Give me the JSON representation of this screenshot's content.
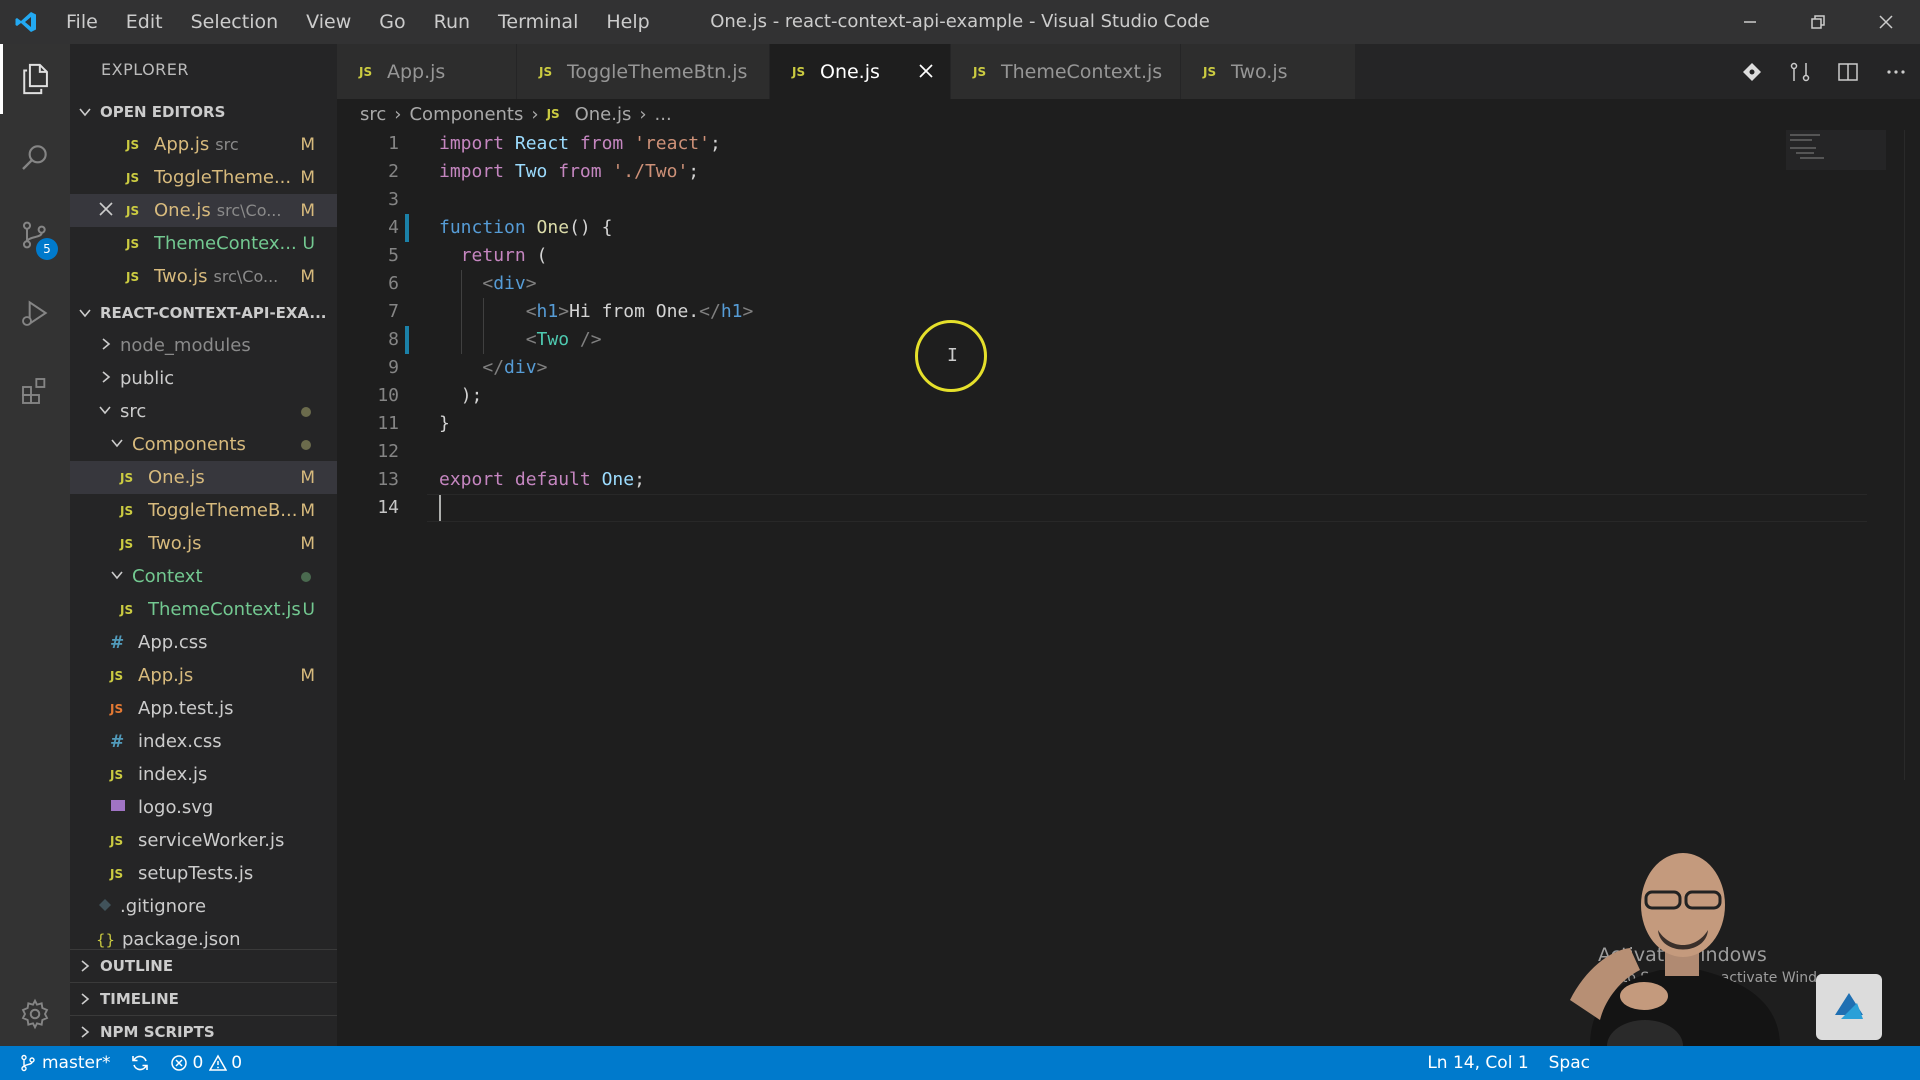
{
  "window": {
    "title": "One.js - react-context-api-example - Visual Studio Code",
    "menu": [
      "File",
      "Edit",
      "Selection",
      "View",
      "Go",
      "Run",
      "Terminal",
      "Help"
    ]
  },
  "activity_bar": {
    "items": [
      "explorer-icon",
      "search-icon",
      "source-control-icon",
      "run-debug-icon",
      "extensions-icon"
    ],
    "scm_badge": "5",
    "bottom": "gear-icon"
  },
  "sidebar": {
    "title": "EXPLORER",
    "open_editors": {
      "header": "OPEN EDITORS",
      "items": [
        {
          "name": "App.js",
          "desc": "src",
          "status": "M"
        },
        {
          "name": "ToggleTheme...",
          "desc": "",
          "status": "M"
        },
        {
          "name": "One.js",
          "desc": "src\\Co...",
          "status": "M"
        },
        {
          "name": "ThemeContex...",
          "desc": "",
          "status": "U"
        },
        {
          "name": "Two.js",
          "desc": "src\\Co...",
          "status": "M"
        }
      ]
    },
    "project": {
      "header": "REACT-CONTEXT-API-EXA...",
      "tree": [
        {
          "name": "node_modules",
          "status": ""
        },
        {
          "name": "public",
          "status": ""
        },
        {
          "name": "src",
          "status": ""
        },
        {
          "name": "Components",
          "status": ""
        },
        {
          "name": "One.js",
          "status": "M"
        },
        {
          "name": "ToggleThemeB...",
          "status": "M"
        },
        {
          "name": "Two.js",
          "status": "M"
        },
        {
          "name": "Context",
          "status": ""
        },
        {
          "name": "ThemeContext.js",
          "status": "U"
        },
        {
          "name": "App.css",
          "status": ""
        },
        {
          "name": "App.js",
          "status": "M"
        },
        {
          "name": "App.test.js",
          "status": ""
        },
        {
          "name": "index.css",
          "status": ""
        },
        {
          "name": "index.js",
          "status": ""
        },
        {
          "name": "logo.svg",
          "status": ""
        },
        {
          "name": "serviceWorker.js",
          "status": ""
        },
        {
          "name": "setupTests.js",
          "status": ""
        },
        {
          "name": ".gitignore",
          "status": ""
        },
        {
          "name": "package.json",
          "status": ""
        }
      ]
    },
    "sections": [
      "OUTLINE",
      "TIMELINE",
      "NPM SCRIPTS"
    ]
  },
  "tabs": [
    {
      "label": "App.js",
      "active": false
    },
    {
      "label": "ToggleThemeBtn.js",
      "active": false
    },
    {
      "label": "One.js",
      "active": true
    },
    {
      "label": "ThemeContext.js",
      "active": false
    },
    {
      "label": "Two.js",
      "active": false
    }
  ],
  "breadcrumb": [
    "src",
    "Components",
    "One.js",
    "..."
  ],
  "editor": {
    "line_numbers": [
      "1",
      "2",
      "3",
      "4",
      "5",
      "6",
      "7",
      "8",
      "9",
      "10",
      "11",
      "12",
      "13",
      "14"
    ],
    "lines": {
      "l1": {
        "kw": "import",
        "id": "React",
        "kw2": "from",
        "str": "'react'",
        "end": ";"
      },
      "l2": {
        "kw": "import",
        "id": "Two",
        "kw2": "from",
        "str": "'./Two'",
        "end": ";"
      },
      "l4": {
        "kw": "function",
        "fn": "One",
        "rest": "() {"
      },
      "l5": {
        "kw": "return",
        "rest": " ("
      },
      "l6": {
        "open": "<",
        "tag": "div",
        "close": ">"
      },
      "l7": {
        "open": "<",
        "tag": "h1",
        "close": ">",
        "text": "Hi from One.",
        "open2": "</",
        "tag2": "h1",
        "close2": ">"
      },
      "l8": {
        "open": "<",
        "cmp": "Two",
        "close": " />"
      },
      "l9": {
        "open": "</",
        "tag": "div",
        "close": ">"
      },
      "l10": {
        "rest": ");"
      },
      "l11": {
        "rest": "}"
      },
      "l13": {
        "kw": "export",
        "kw2": "default",
        "id": "One",
        "end": ";"
      }
    }
  },
  "status_bar": {
    "branch": "master*",
    "errors": "0",
    "warnings": "0",
    "position": "Ln 14, Col 1",
    "spaces": "Spac"
  },
  "watermark": {
    "line1": "Activate Windows",
    "line2": "Go to Settings to activate Windows."
  },
  "colors": {
    "accent": "#007acc",
    "modified": "#d7ba7d",
    "untracked": "#73c991",
    "js_icon": "#cbcb41",
    "cursor_ring": "#e5e02b"
  }
}
